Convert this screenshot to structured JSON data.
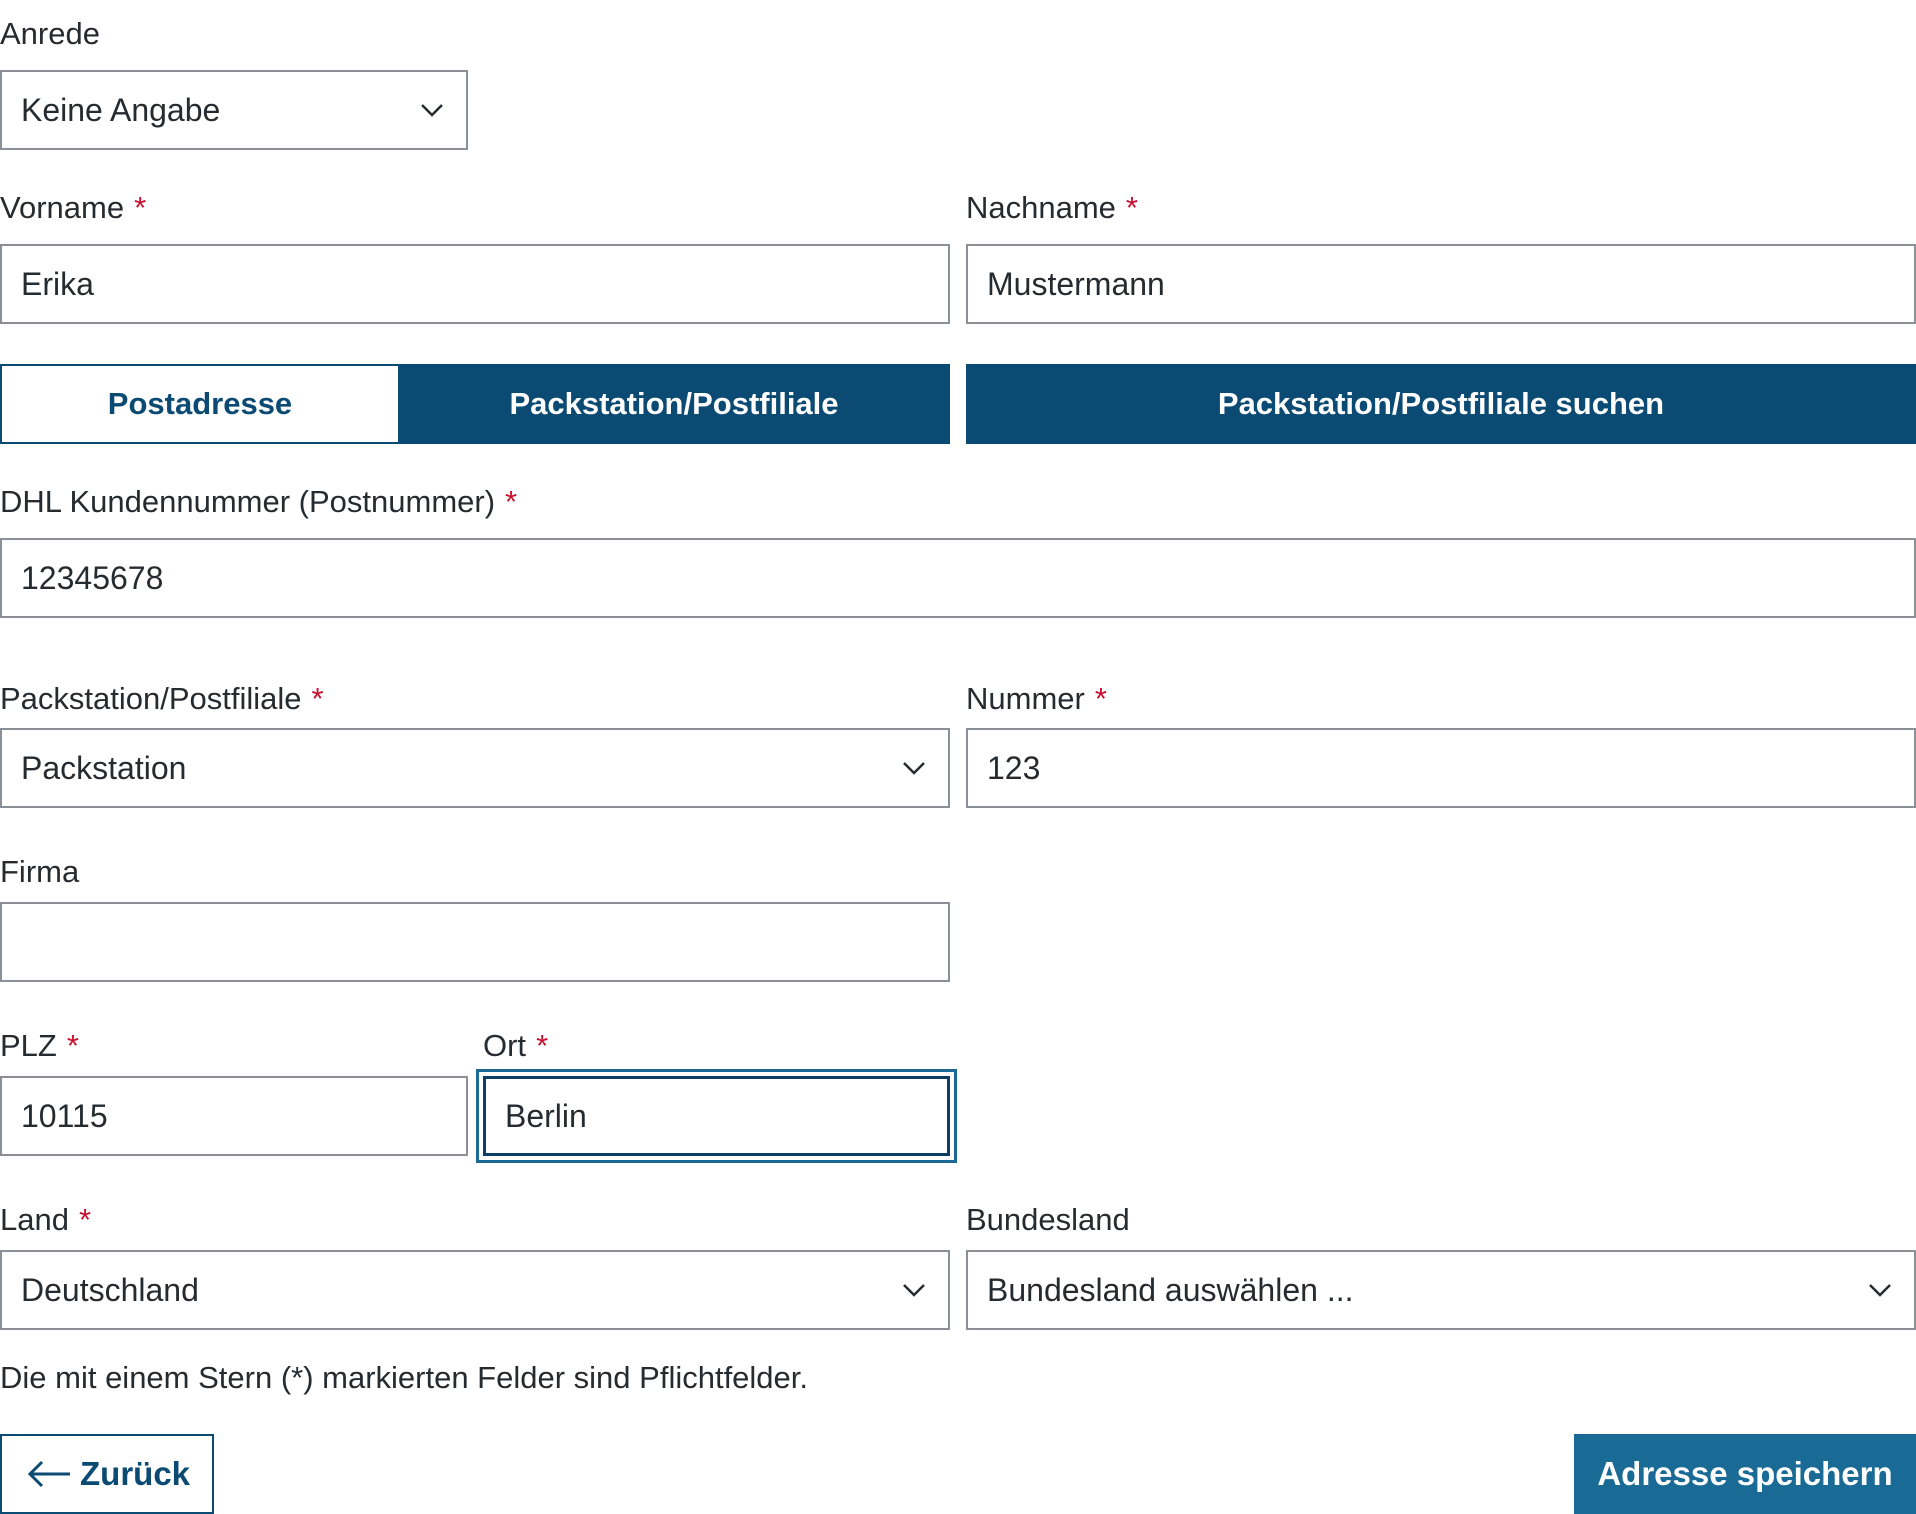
{
  "form": {
    "salutation": {
      "label": "Anrede",
      "value": "Keine Angabe"
    },
    "first_name": {
      "label": "Vorname",
      "required": "*",
      "value": "Erika"
    },
    "last_name": {
      "label": "Nachname",
      "required": "*",
      "value": "Mustermann"
    },
    "address_type": {
      "options": [
        "Postadresse",
        "Packstation/Postfiliale"
      ],
      "selected": "Packstation/Postfiliale",
      "search_label": "Packstation/Postfiliale suchen"
    },
    "dhl_customer_number": {
      "label": "DHL Kundennummer (Postnummer)",
      "required": "*",
      "value": "12345678"
    },
    "station_type": {
      "label": "Packstation/Postfiliale",
      "required": "*",
      "value": "Packstation"
    },
    "station_number": {
      "label": "Nummer",
      "required": "*",
      "value": "123"
    },
    "company": {
      "label": "Firma",
      "value": ""
    },
    "zip": {
      "label": "PLZ",
      "required": "*",
      "value": "10115"
    },
    "city": {
      "label": "Ort",
      "required": "*",
      "value": "Berlin"
    },
    "country": {
      "label": "Land",
      "required": "*",
      "value": "Deutschland"
    },
    "state": {
      "label": "Bundesland",
      "value": "Bundesland auswählen ..."
    },
    "required_note": "Die mit einem Stern (*) markierten Felder sind Pflichtfelder."
  },
  "actions": {
    "back_label": "Zurück",
    "save_label": "Adresse speichern"
  },
  "colors": {
    "primary": "#0b4a72",
    "button": "#1a6a96",
    "required": "#c8102e",
    "border": "#8a9096"
  },
  "icons": {
    "select_chevron": "chevron-down-icon",
    "back_arrow": "arrow-left-icon"
  }
}
